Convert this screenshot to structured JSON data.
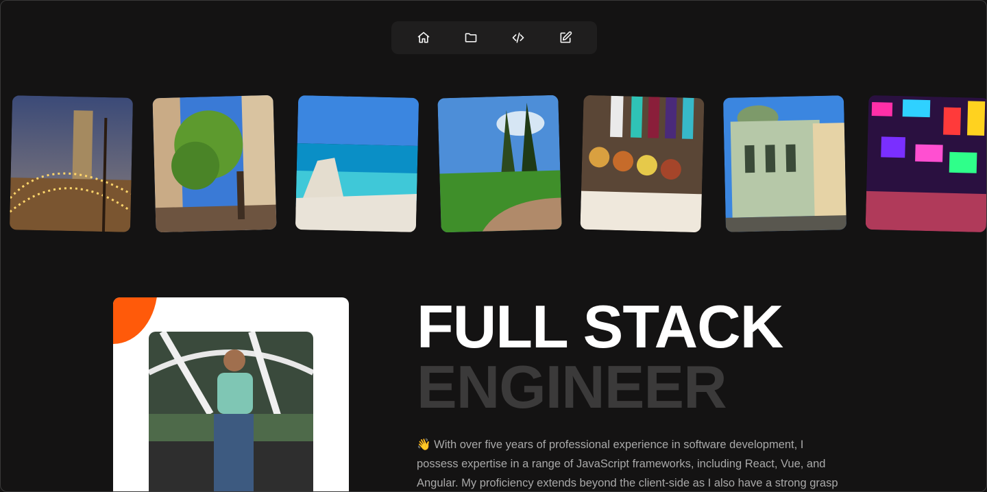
{
  "nav": {
    "items": [
      {
        "icon": "home-icon",
        "label": "Home"
      },
      {
        "icon": "folder-icon",
        "label": "Projects"
      },
      {
        "icon": "code-icon",
        "label": "Code"
      },
      {
        "icon": "edit-icon",
        "label": "Blog"
      }
    ]
  },
  "gallery": {
    "photos": [
      {
        "subject": "night courtyard with string lights"
      },
      {
        "subject": "sunlit alley with tree"
      },
      {
        "subject": "sea rock and beach"
      },
      {
        "subject": "garden path with cypress trees"
      },
      {
        "subject": "market stall with spices and scarves"
      },
      {
        "subject": "historic building with domes"
      },
      {
        "subject": "neon lit street"
      }
    ]
  },
  "hero": {
    "title_line1": "FULL STACK",
    "title_line2": "ENGINEER",
    "description": "👋 With over five years of professional experience in software development, I possess expertise in a range of JavaScript frameworks, including React, Vue, and Angular. My proficiency extends beyond the client-side as I also have a strong grasp of back-end"
  },
  "colors": {
    "background": "#141313",
    "accent": "#ff5a0a",
    "title": "#ffffff",
    "title_muted": "#3b3a3a",
    "body_text": "#a9a9a9"
  }
}
